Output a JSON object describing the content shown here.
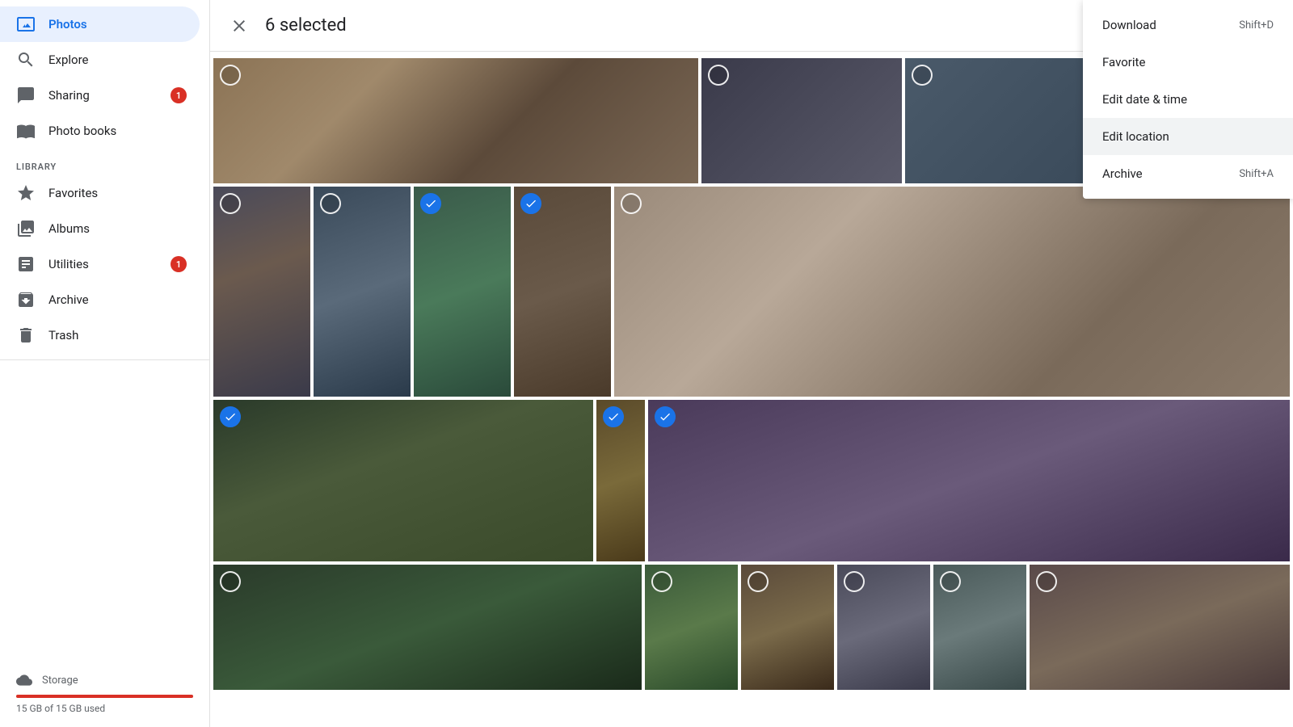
{
  "sidebar": {
    "items": [
      {
        "id": "photos",
        "label": "Photos",
        "active": true,
        "badge": null
      },
      {
        "id": "explore",
        "label": "Explore",
        "active": false,
        "badge": null
      },
      {
        "id": "sharing",
        "label": "Sharing",
        "active": false,
        "badge": "1"
      },
      {
        "id": "photo-books",
        "label": "Photo books",
        "active": false,
        "badge": null
      }
    ],
    "library_label": "LIBRARY",
    "library_items": [
      {
        "id": "favorites",
        "label": "Favorites",
        "badge": null
      },
      {
        "id": "albums",
        "label": "Albums",
        "badge": null
      },
      {
        "id": "utilities",
        "label": "Utilities",
        "badge": "1"
      },
      {
        "id": "archive",
        "label": "Archive",
        "badge": null
      },
      {
        "id": "trash",
        "label": "Trash",
        "badge": null
      }
    ],
    "storage": {
      "label": "Storage",
      "used": "15 GB of 15 GB used",
      "percent": 100
    }
  },
  "topbar": {
    "selected_count": "6 selected",
    "close_title": "Close selection"
  },
  "context_menu": {
    "items": [
      {
        "id": "download",
        "label": "Download",
        "shortcut": "Shift+D"
      },
      {
        "id": "favorite",
        "label": "Favorite",
        "shortcut": ""
      },
      {
        "id": "edit-date-time",
        "label": "Edit date & time",
        "shortcut": ""
      },
      {
        "id": "edit-location",
        "label": "Edit location",
        "shortcut": "",
        "active": true
      },
      {
        "id": "archive",
        "label": "Archive",
        "shortcut": "Shift+A"
      }
    ]
  }
}
